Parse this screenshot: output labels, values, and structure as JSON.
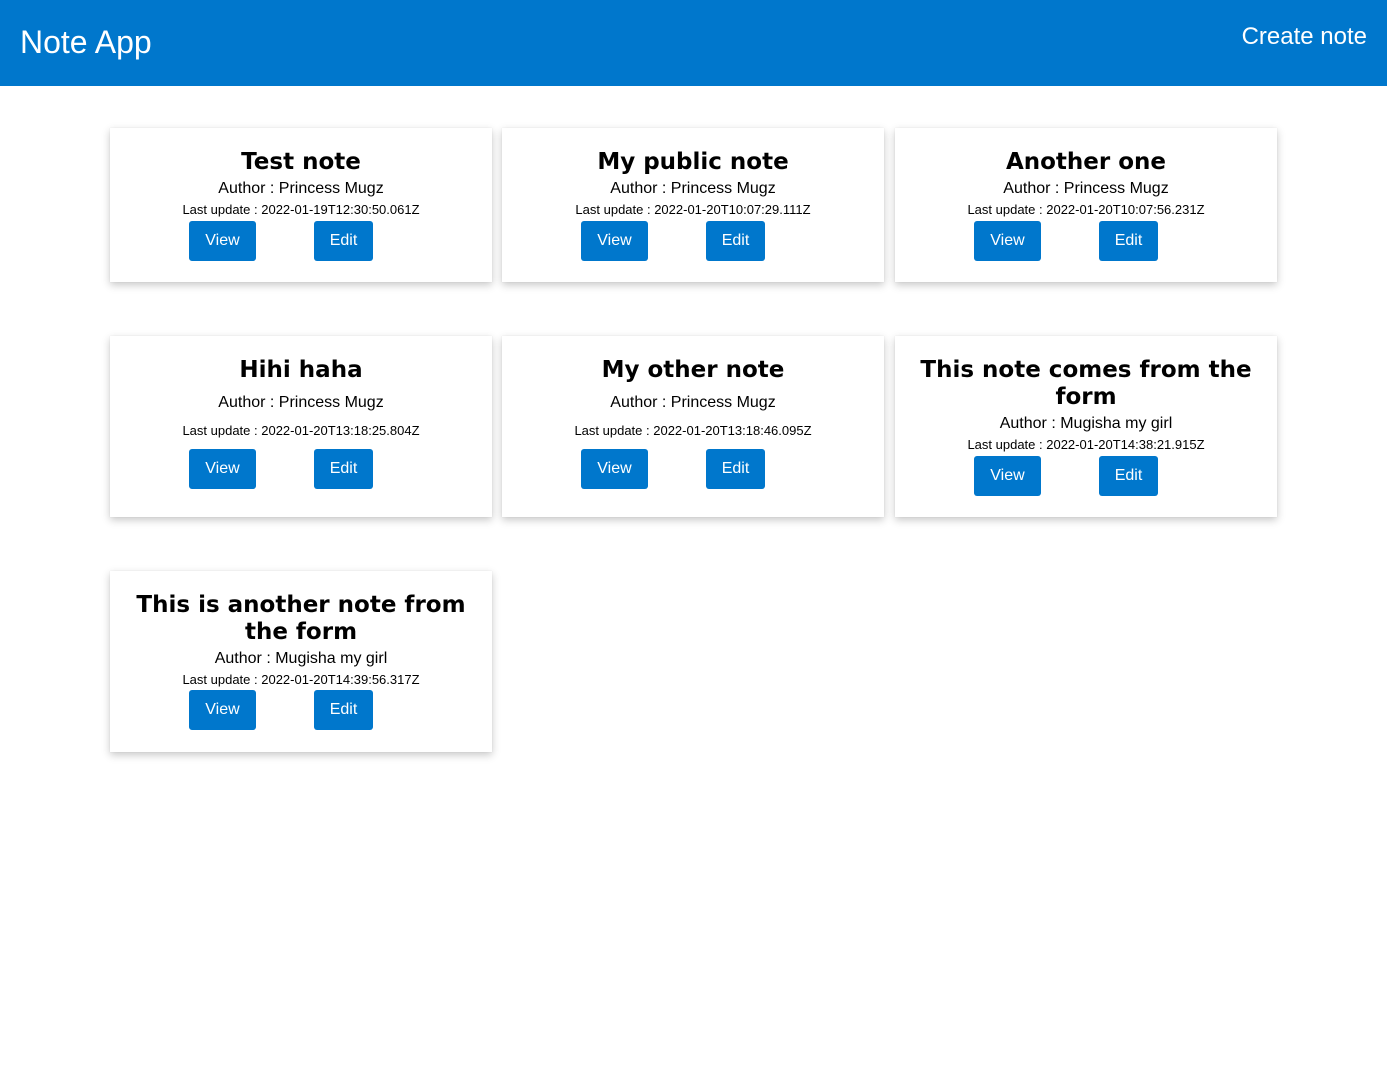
{
  "header": {
    "title": "Note App",
    "create_label": "Create note"
  },
  "colors": {
    "primary": "#0077cc",
    "background": "#ffffff",
    "text": "#000000"
  },
  "notes": [
    {
      "title": "Test note",
      "author": "Author : Princess Mugz",
      "updated": "Last update : 2022-01-19T12:30:50.061Z",
      "view_label": "View",
      "edit_label": "Edit"
    },
    {
      "title": "My public note",
      "author": "Author : Princess Mugz",
      "updated": "Last update : 2022-01-20T10:07:29.111Z",
      "view_label": "View",
      "edit_label": "Edit"
    },
    {
      "title": "Another one",
      "author": "Author : Princess Mugz",
      "updated": "Last update : 2022-01-20T10:07:56.231Z",
      "view_label": "View",
      "edit_label": "Edit"
    },
    {
      "title": "Hihi haha",
      "author": "Author : Princess Mugz",
      "updated": "Last update : 2022-01-20T13:18:25.804Z",
      "view_label": "View",
      "edit_label": "Edit"
    },
    {
      "title": "My other note",
      "author": "Author : Princess Mugz",
      "updated": "Last update : 2022-01-20T13:18:46.095Z",
      "view_label": "View",
      "edit_label": "Edit"
    },
    {
      "title": "This note comes from the form",
      "author": "Author : Mugisha my girl",
      "updated": "Last update : 2022-01-20T14:38:21.915Z",
      "view_label": "View",
      "edit_label": "Edit"
    },
    {
      "title": "This is another note from the form",
      "author": "Author : Mugisha my girl",
      "updated": "Last update : 2022-01-20T14:39:56.317Z",
      "view_label": "View",
      "edit_label": "Edit"
    }
  ]
}
